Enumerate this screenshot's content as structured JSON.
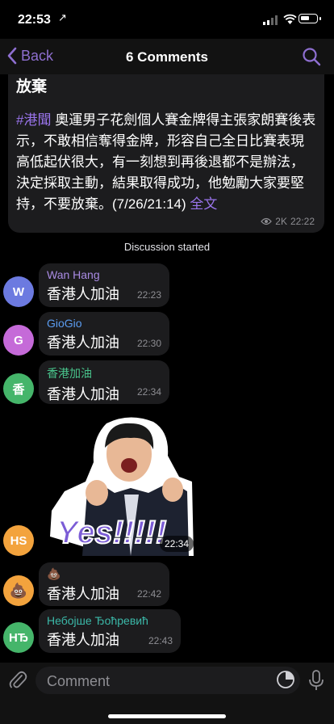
{
  "status": {
    "time": "22:53",
    "location_arrow": "↗"
  },
  "nav": {
    "back_label": "Back",
    "title": "6 Comments"
  },
  "post": {
    "headline": "放棄",
    "hashtag": "#港聞",
    "body": " 奧運男子花劍個人賽金牌得主張家朗賽後表示，不敢相信奪得金牌，形容自己全日比賽表現高低起伏很大，有一刻想到再後退都不是辦法，決定採取主動，結果取得成功，他勉勵大家要堅持，不要放棄。(7/26/21:14) ",
    "full_text_label": "全文",
    "views": "2K",
    "time": "22:22"
  },
  "system_note": "Discussion started",
  "messages": [
    {
      "initials": "W",
      "name": "Wan Hang",
      "text": "香港人加油",
      "time": "22:23",
      "name_color": "#a98be3",
      "avatar_color": "#6c7ae0"
    },
    {
      "initials": "G",
      "name": "GioGio",
      "text": "香港人加油",
      "time": "22:30",
      "name_color": "#5b9cf0",
      "avatar_color": "#c56ad8"
    },
    {
      "initials": "香",
      "name": "香港加油",
      "text": "香港人加油",
      "time": "22:34",
      "name_color": "#48c38b",
      "avatar_color": "#45b56a"
    },
    {
      "initials": "HS",
      "sticker_text": "Yes!!!!!",
      "time": "22:34",
      "avatar_color": "#f3a33d"
    },
    {
      "initials": "💩",
      "name": "💩",
      "text": "香港人加油",
      "time": "22:42",
      "avatar_color": "#f3a33d"
    },
    {
      "initials": "НЂ",
      "name": "Небојше Ђоћревић",
      "text": "香港人加油",
      "time": "22:43",
      "name_color": "#3bb8a8",
      "avatar_color": "#45b56a"
    }
  ],
  "input": {
    "placeholder": "Comment"
  }
}
